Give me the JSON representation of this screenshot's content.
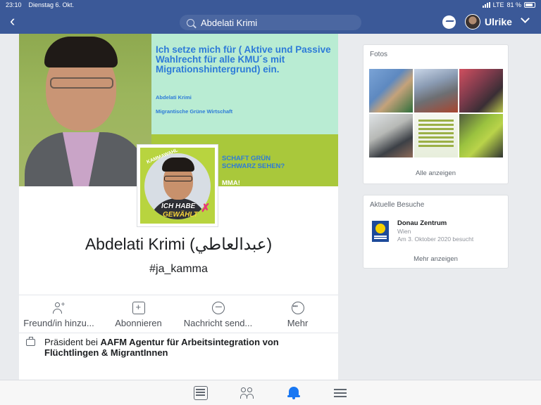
{
  "statusbar": {
    "time": "23:10",
    "date": "Dienstag 6. Okt.",
    "network": "LTE",
    "battery": "81 %"
  },
  "navbar": {
    "search_value": "Abdelati Krimi",
    "user_name": "Ulrike"
  },
  "cover": {
    "headline": "Ich setze mich für ( Aktive und Passive Wahlrecht für alle KMU´s mit Migrationshintergrund) ein.",
    "line1": "Abdelati Krimi",
    "line2": "Migrantische Grüne Wirtschaft",
    "green_line1": "SCHAFT GRÜN",
    "green_line2": "SCHWARZ SEHEN?",
    "green_line3": "MMA!"
  },
  "profile_pic": {
    "stamp_top": "KAMMAWAHL",
    "stamp_line1": "ICH HABE",
    "stamp_line2": "GEWÄHLT"
  },
  "profile": {
    "name": "Abdelati Krimi (عبدالعاطي)",
    "username": "#ja_kamma"
  },
  "actions": [
    {
      "label": "Freund/in hinzu...",
      "icon": "add-friend-icon"
    },
    {
      "label": "Abonnieren",
      "icon": "subscribe-icon"
    },
    {
      "label": "Nachricht send...",
      "icon": "messenger-icon"
    },
    {
      "label": "Mehr",
      "icon": "more-icon"
    }
  ],
  "job": {
    "prefix": "Präsident bei ",
    "org": "AAFM Agentur für Arbeitsintegration von Flüchtlingen & MigrantInnen"
  },
  "photos_card": {
    "title": "Fotos",
    "link": "Alle anzeigen"
  },
  "visits_card": {
    "title": "Aktuelle Besuche",
    "place_name": "Donau Zentrum",
    "place_city": "Wien",
    "place_date": "Am 3. Oktober 2020 besucht",
    "link": "Mehr anzeigen"
  },
  "colors": {
    "brand": "#3b5998",
    "accent": "#1877f2",
    "cover_green": "#a9c83b"
  }
}
